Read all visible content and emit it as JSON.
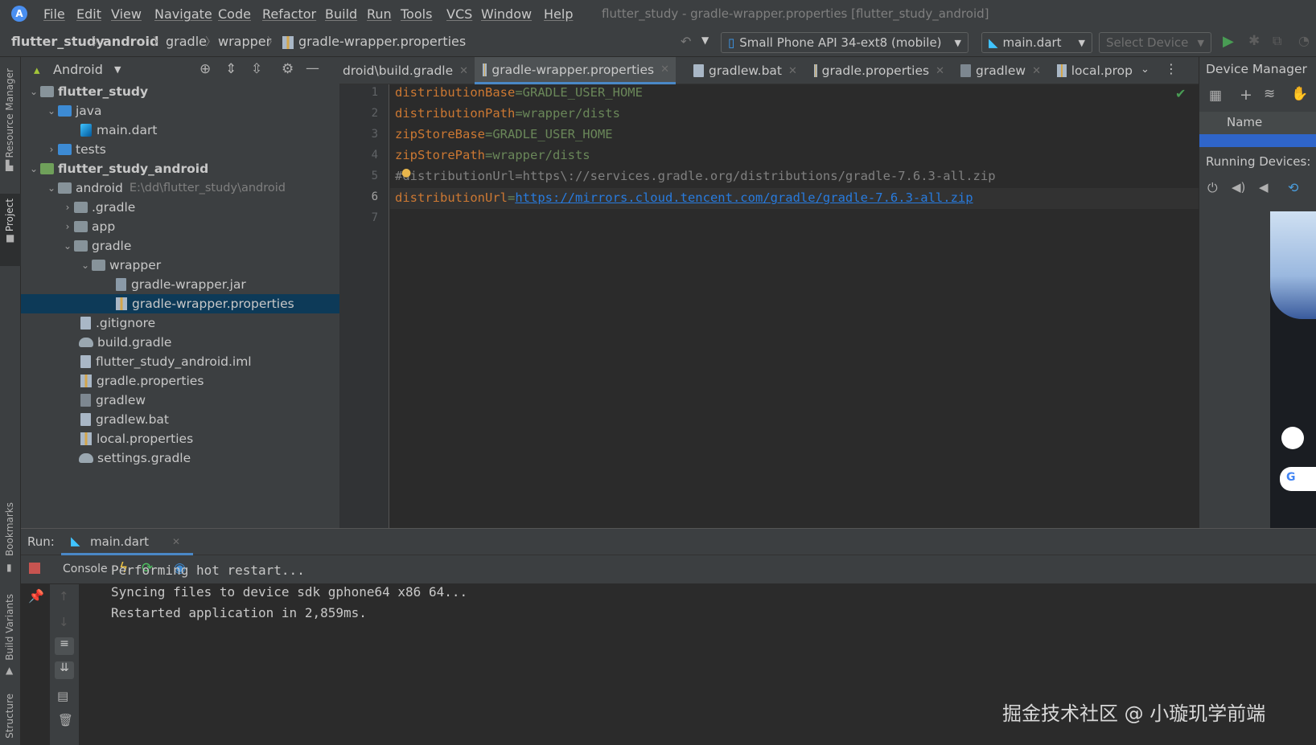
{
  "window": {
    "title": "flutter_study - gradle-wrapper.properties [flutter_study_android]",
    "menu": [
      "File",
      "Edit",
      "View",
      "Navigate",
      "Code",
      "Refactor",
      "Build",
      "Run",
      "Tools",
      "VCS",
      "Window",
      "Help"
    ]
  },
  "breadcrumb": [
    "flutter_study",
    "android",
    "gradle",
    "wrapper",
    "gradle-wrapper.properties"
  ],
  "toolbar": {
    "device_config": "Small Phone API 34-ext8 (mobile)",
    "run_config": "main.dart",
    "select_device": "Select Device"
  },
  "left_strip": {
    "resource_manager": "Resource Manager",
    "project": "Project",
    "bookmarks": "Bookmarks",
    "build_variants": "Build Variants",
    "structure": "Structure"
  },
  "project_panel": {
    "view": "Android",
    "tree": [
      {
        "label": "flutter_study",
        "bold": true
      },
      {
        "label": "java"
      },
      {
        "label": "main.dart"
      },
      {
        "label": "tests"
      },
      {
        "label": "flutter_study_android",
        "bold": true
      },
      {
        "label": "android",
        "path": "E:\\dd\\flutter_study\\android"
      },
      {
        "label": ".gradle"
      },
      {
        "label": "app"
      },
      {
        "label": "gradle"
      },
      {
        "label": "wrapper"
      },
      {
        "label": "gradle-wrapper.jar"
      },
      {
        "label": "gradle-wrapper.properties",
        "selected": true
      },
      {
        "label": ".gitignore"
      },
      {
        "label": "build.gradle"
      },
      {
        "label": "flutter_study_android.iml"
      },
      {
        "label": "gradle.properties"
      },
      {
        "label": "gradlew"
      },
      {
        "label": "gradlew.bat"
      },
      {
        "label": "local.properties"
      },
      {
        "label": "settings.gradle"
      }
    ]
  },
  "editor_tabs": [
    {
      "label": "droid\\build.gradle"
    },
    {
      "label": "gradle-wrapper.properties",
      "active": true
    },
    {
      "label": "gradlew.bat"
    },
    {
      "label": "gradle.properties"
    },
    {
      "label": "gradlew"
    },
    {
      "label": "local.prop"
    }
  ],
  "editor": {
    "line_numbers": [
      "1",
      "2",
      "3",
      "4",
      "5",
      "6",
      "7"
    ],
    "lines": [
      {
        "key": "distributionBase",
        "eq": "=",
        "value": "GRADLE_USER_HOME"
      },
      {
        "key": "distributionPath",
        "eq": "=",
        "value": "wrapper/dists"
      },
      {
        "key": "zipStoreBase",
        "eq": "=",
        "value": "GRADLE_USER_HOME"
      },
      {
        "key": "zipStorePath",
        "eq": "=",
        "value": "wrapper/dists"
      },
      {
        "comment": "#distributionUrl=https\\://services.gradle.org/distributions/gradle-7.6.3-all.zip"
      },
      {
        "key": "distributionUrl",
        "eq": "=",
        "url": "https://mirrors.cloud.tencent.com/gradle/gradle-7.6.3-all.zip"
      }
    ]
  },
  "device_manager": {
    "title": "Device Manager",
    "name_header": "Name",
    "running_devices": "Running Devices:"
  },
  "run_panel": {
    "label": "Run:",
    "tab": "main.dart",
    "console_tab": "Console",
    "output": [
      "Performing hot restart...",
      "Syncing files to device sdk gphone64 x86 64...",
      "Restarted application in 2,859ms."
    ]
  },
  "watermark": "掘金技术社区 @ 小璇玑学前端"
}
